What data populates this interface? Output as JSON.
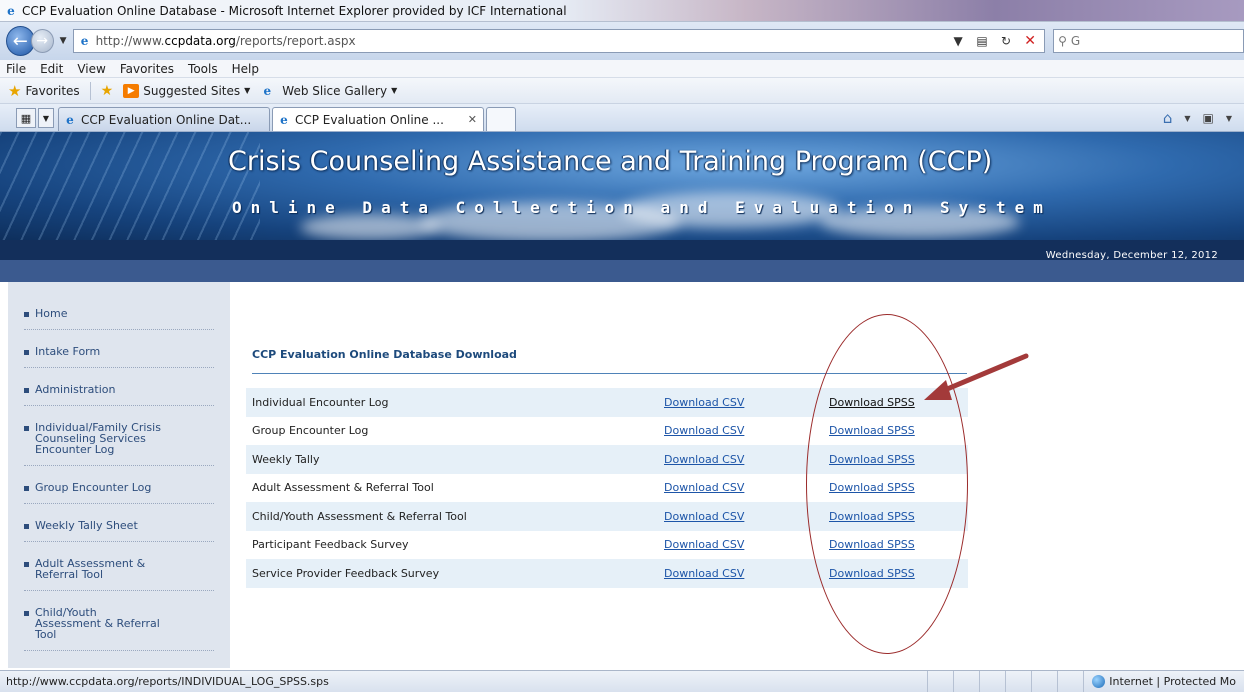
{
  "window": {
    "title": "CCP Evaluation Online Database - Microsoft Internet Explorer provided by ICF International"
  },
  "address": {
    "prefix": "http://www.",
    "domain": "ccpdata.org",
    "path": "/reports/report.aspx"
  },
  "search": {
    "text": "G"
  },
  "menu": [
    "File",
    "Edit",
    "View",
    "Favorites",
    "Tools",
    "Help"
  ],
  "favorites": {
    "label": "Favorites",
    "suggested": "Suggested Sites",
    "webslice": "Web Slice Gallery"
  },
  "tabs": [
    {
      "label": "CCP Evaluation Online Dat..."
    },
    {
      "label": "CCP Evaluation Online ..."
    }
  ],
  "banner": {
    "title": "Crisis Counseling Assistance and Training Program (CCP)",
    "subtitle": "Online Data Collection and Evaluation System",
    "date": "Wednesday, December 12, 2012"
  },
  "sidebar": {
    "items": [
      {
        "label": "Home"
      },
      {
        "label": "Intake Form"
      },
      {
        "label": "Administration"
      },
      {
        "label": "Individual/Family Crisis\nCounseling Services\nEncounter Log"
      },
      {
        "label": "Group Encounter Log"
      },
      {
        "label": "Weekly Tally Sheet"
      },
      {
        "label": "Adult Assessment &\nReferral Tool"
      },
      {
        "label": "Child/Youth\nAssessment & Referral\nTool"
      }
    ]
  },
  "content": {
    "title": "CCP Evaluation Online Database Download",
    "rows": [
      {
        "name": "Individual Encounter Log",
        "csv": "Download CSV",
        "spss": "Download SPSS"
      },
      {
        "name": "Group Encounter Log",
        "csv": "Download CSV",
        "spss": "Download SPSS"
      },
      {
        "name": "Weekly Tally",
        "csv": "Download CSV",
        "spss": "Download SPSS"
      },
      {
        "name": "Adult Assessment & Referral Tool",
        "csv": "Download CSV",
        "spss": "Download SPSS"
      },
      {
        "name": "Child/Youth Assessment & Referral Tool",
        "csv": "Download CSV",
        "spss": "Download SPSS"
      },
      {
        "name": "Participant Feedback Survey",
        "csv": "Download CSV",
        "spss": "Download SPSS"
      },
      {
        "name": "Service Provider Feedback Survey",
        "csv": "Download CSV",
        "spss": "Download SPSS"
      }
    ]
  },
  "status": {
    "url": "http://www.ccpdata.org/reports/INDIVIDUAL_LOG_SPSS.sps",
    "zone": "Internet | Protected Mo"
  },
  "colors": {
    "annotation": "#9b2b2b",
    "link": "#1d55a8",
    "banner_dark": "#132f5b"
  }
}
